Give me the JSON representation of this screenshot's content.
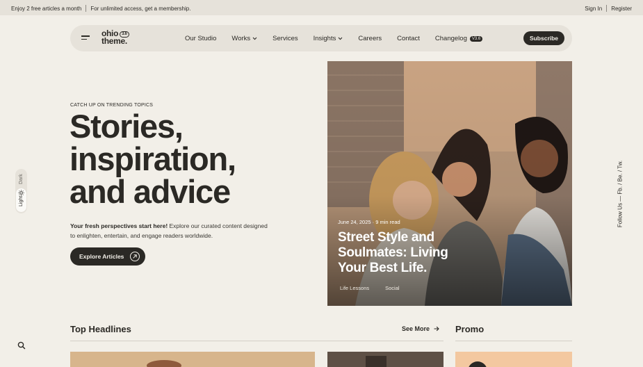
{
  "topbar": {
    "offer": "Enjoy 2 free articles a month",
    "offer_cta": "For unlimited access, get a membership.",
    "signin": "Sign In",
    "register": "Register"
  },
  "logo": {
    "line1": "ohio",
    "line2": "theme.",
    "version": "3.6"
  },
  "nav": {
    "items": [
      {
        "label": "Our Studio",
        "dropdown": false
      },
      {
        "label": "Works",
        "dropdown": true
      },
      {
        "label": "Services",
        "dropdown": false
      },
      {
        "label": "Insights",
        "dropdown": true
      },
      {
        "label": "Careers",
        "dropdown": false
      },
      {
        "label": "Contact",
        "dropdown": false
      },
      {
        "label": "Changelog",
        "dropdown": false,
        "badge": "V3.6"
      }
    ],
    "subscribe": "Subscribe"
  },
  "mode": {
    "dark": "Dark",
    "light": "Light"
  },
  "follow": "Follow Us — Fb. / Be. / Tw.",
  "hero": {
    "eyebrow": "CATCH UP ON TRENDING TOPICS",
    "headline": [
      "Stories,",
      "inspiration,",
      "and advice"
    ],
    "intro_bold": "Your fresh perspectives start here!",
    "intro_rest": " Explore our curated content designed to enlighten, entertain, and engage readers worldwide.",
    "cta": "Explore Articles"
  },
  "feature": {
    "date": "June 24, 2025",
    "read_time": "9 min read",
    "title": "Street Style and Soulmates: Living Your Best Life.",
    "tags": [
      "Life Lessons",
      "Social"
    ]
  },
  "sections": {
    "top_headlines": "Top Headlines",
    "see_more": "See More",
    "promo": "Promo"
  },
  "colors": {
    "background": "#f2efe8",
    "bar": "#e6e2da",
    "ink": "#2b2925"
  },
  "icons": {
    "menu": "hamburger-icon",
    "search": "search-icon",
    "arrow": "arrow-right-icon",
    "sun": "sun-icon"
  }
}
